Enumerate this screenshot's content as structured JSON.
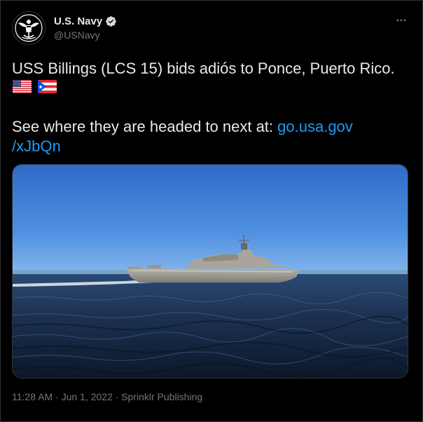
{
  "author": {
    "name": "U.S. Navy",
    "handle": "@USNavy"
  },
  "icons": {
    "avatar": "navy-seal-eagle-icon",
    "verified": "verified-badge-icon",
    "more": "more-horizontal-icon",
    "flag_us": "us-flag-emoji",
    "flag_pr": "puerto-rico-flag-emoji"
  },
  "tweet": {
    "line1": "USS Billings (LCS 15) bids adiós to Ponce, Puerto Rico.",
    "line2_prefix": "See where they are headed to next at: ",
    "link_part1": "go.usa.gov",
    "link_part2": "/xJbQn"
  },
  "media": {
    "subject": "ship-at-sea-photo"
  },
  "meta": {
    "time": "11:28 AM",
    "sep1": " · ",
    "date": "Jun 1, 2022",
    "sep2": " · ",
    "source": "Sprinklr Publishing"
  },
  "colors": {
    "background": "#000000",
    "text": "#e7e9ea",
    "secondary": "#71767b",
    "link": "#1d9bf0",
    "verified": "#d9d9d9"
  }
}
